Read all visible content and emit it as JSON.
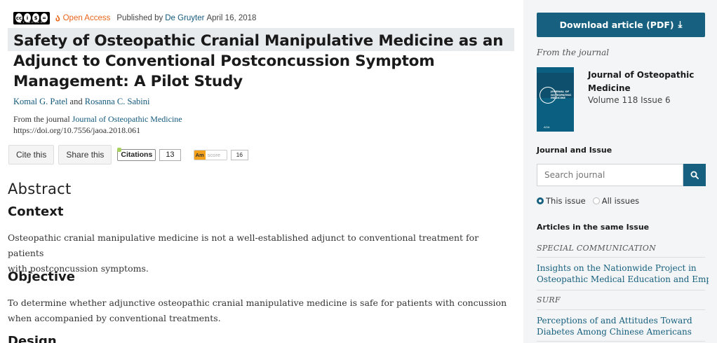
{
  "meta": {
    "cc_badge": "BY NC ND",
    "open_access": "Open Access",
    "published_by": "Published by",
    "publisher": "De Gruyter",
    "date": "April 16, 2018"
  },
  "article": {
    "title_line1": "Safety of Osteopathic Cranial Manipulative Medicine as an",
    "title_line2": "Adjunct to Conventional Postconcussion Symptom",
    "title_line3": "Management: A Pilot Study",
    "author1": "Komal G. Patel",
    "author_and": " and ",
    "author2": "Rosanna C. Sabini",
    "from_prefix": "From the journal ",
    "journal": "Journal of Osteopathic Medicine",
    "doi": "https://doi.org/10.7556/jaoa.2018.061"
  },
  "actions": {
    "cite": "Cite this",
    "share": "Share this",
    "citations_label": "Citations",
    "citations_count": "13",
    "altmetric_am": "Am",
    "altmetric_score_label": "score",
    "altmetric_count": "16"
  },
  "abstract": {
    "heading": "Abstract",
    "sections": [
      {
        "heading": "Context",
        "line1": "Osteopathic cranial manipulative medicine is not a well-established adjunct to conventional treatment for patients",
        "line2": "with postconcussion symptoms."
      },
      {
        "heading": "Objective",
        "line1": "To determine whether adjunctive osteopathic cranial manipulative medicine is safe for patients with concussion",
        "line2": "when accompanied by conventional treatments."
      },
      {
        "heading": "Design"
      }
    ]
  },
  "sidebar": {
    "download_label": "Download article (PDF)",
    "from_journal_label": "From the journal",
    "journal_name": "Journal of Osteopathic Medicine",
    "volume_issue": "Volume 118 Issue 6",
    "cover_text": "JOURNAL OF OSTEOPATHIC MEDICINE",
    "journal_issue_heading": "Journal and Issue",
    "search_placeholder": "Search journal",
    "radio_this_issue": "This issue",
    "radio_all_issues": "All issues",
    "articles_heading": "Articles in the same Issue",
    "articles": [
      {
        "category": "SPECIAL COMMUNICATION",
        "title_line1": "Insights on the Nationwide Project in",
        "title_line2": "Osteopathic Medical Education and Empath..."
      },
      {
        "category": "SURF",
        "title_line1": "Perceptions of and Attitudes Toward",
        "title_line2": "Diabetes Among Chinese Americans"
      }
    ]
  },
  "colors": {
    "accent": "#17607f",
    "link": "#12587a",
    "open_access": "#e8641b"
  }
}
